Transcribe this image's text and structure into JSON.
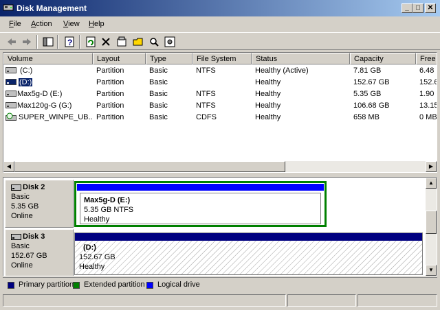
{
  "window": {
    "title": "Disk Management"
  },
  "menu": {
    "items": [
      "File",
      "Action",
      "View",
      "Help"
    ],
    "accel": [
      "F",
      "A",
      "V",
      "H"
    ]
  },
  "list": {
    "columns": [
      "Volume",
      "Layout",
      "Type",
      "File System",
      "Status",
      "Capacity",
      "Free"
    ],
    "rows": [
      {
        "volume": "(C:)",
        "layout": "Partition",
        "type": "Basic",
        "fs": "NTFS",
        "status": "Healthy (Active)",
        "capacity": "7.81 GB",
        "free": "6.48"
      },
      {
        "volume": "(D:)",
        "layout": "Partition",
        "type": "Basic",
        "fs": "",
        "status": "Healthy",
        "capacity": "152.67 GB",
        "free": "152.6"
      },
      {
        "volume": "Max5g-D (E:)",
        "layout": "Partition",
        "type": "Basic",
        "fs": "NTFS",
        "status": "Healthy",
        "capacity": "5.35 GB",
        "free": "1.90"
      },
      {
        "volume": "Max120g-G (G:)",
        "layout": "Partition",
        "type": "Basic",
        "fs": "NTFS",
        "status": "Healthy",
        "capacity": "106.68 GB",
        "free": "13.15"
      },
      {
        "volume": "SUPER_WINPE_UB...",
        "layout": "Partition",
        "type": "Basic",
        "fs": "CDFS",
        "status": "Healthy",
        "capacity": "658 MB",
        "free": "0 MB"
      }
    ],
    "selected_row": 1
  },
  "disks": [
    {
      "name": "Disk 2",
      "type": "Basic",
      "size": "5.35 GB",
      "state": "Online",
      "partition": {
        "label": "Max5g-D  (E:)",
        "detail": "5.35 GB NTFS",
        "status": "Healthy"
      }
    },
    {
      "name": "Disk 3",
      "type": "Basic",
      "size": "152.67 GB",
      "state": "Online",
      "partition": {
        "label": "(D:)",
        "detail": "152.67 GB",
        "status": "Healthy"
      }
    }
  ],
  "legend": {
    "items": [
      {
        "label": "Primary partition",
        "color": "#000080"
      },
      {
        "label": "Extended partition",
        "color": "#008000"
      },
      {
        "label": "Logical drive",
        "color": "#0000ff"
      }
    ]
  },
  "colors": {
    "selection": "#0a246a",
    "primary": "#000080",
    "extended": "#008000",
    "logical": "#0000ff"
  }
}
